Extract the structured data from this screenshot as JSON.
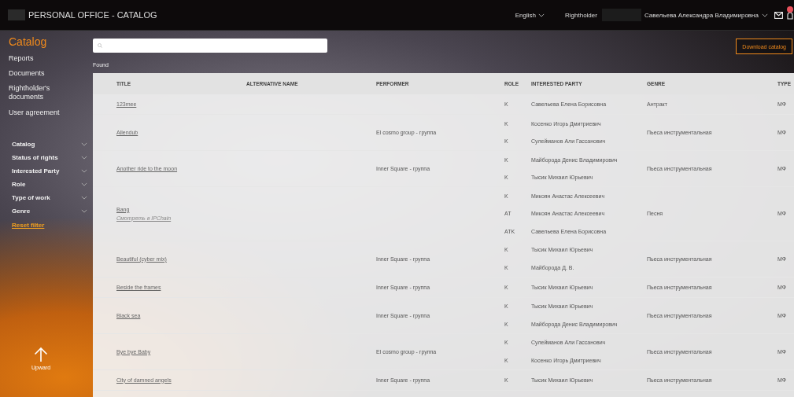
{
  "top_bar": {
    "title": "PERSONAL OFFICE - CATALOG",
    "language": "English",
    "role_label": "Rightholder",
    "user_name": "Савельева Александра Владимировна"
  },
  "sidebar": {
    "nav": [
      {
        "label": "Catalog",
        "selected": true
      },
      {
        "label": "Reports",
        "selected": false
      },
      {
        "label": "Documents",
        "selected": false
      },
      {
        "label": "Rightholder's documents",
        "selected": false
      },
      {
        "label": "User agreement",
        "selected": false
      }
    ],
    "filters": [
      "Catalog",
      "Status of rights",
      "Interested Party",
      "Role",
      "Type of work",
      "Genre"
    ],
    "reset_filter": "Reset filter",
    "upward": "Upward"
  },
  "found_label": "Found",
  "download_button": "Download catalog",
  "table": {
    "columns": [
      "TITLE",
      "ALTERNATIVE NAME",
      "PERFORMER",
      "ROLE",
      "INTERESTED PARTY",
      "GENRE",
      "TYPE"
    ],
    "rows": [
      {
        "title": "123mee",
        "parties": [
          {
            "role": "K",
            "name": "Савельева Елена Борисовна"
          }
        ],
        "genre": "Антракт",
        "type": "МФ"
      },
      {
        "title": "Allendub",
        "performer": "El cosmo group - группа",
        "parties": [
          {
            "role": "K",
            "name": "Косенко Игорь Дмитриевич"
          },
          {
            "role": "K",
            "name": "Сулейманов Али Гассанович"
          }
        ],
        "genre": "Пьеса инструментальная",
        "type": "МФ"
      },
      {
        "title": "Another ride to the moon",
        "performer": "Inner Square - группа",
        "parties": [
          {
            "role": "K",
            "name": "Майборода Денис Владимирович"
          },
          {
            "role": "K",
            "name": "Тысик Михаил Юрьевич"
          }
        ],
        "genre": "Пьеса инструментальная",
        "type": "МФ"
      },
      {
        "title": "Bang",
        "link": "Смотреть в IPChain",
        "parties": [
          {
            "role": "K",
            "name": "Микоян Анастас Алексеевич"
          },
          {
            "role": "AT",
            "name": "Микоян Анастас Алексеевич"
          },
          {
            "role": "ATK",
            "name": "Савельева Елена Борисовна"
          }
        ],
        "genre": "Песня",
        "type": "МФ"
      },
      {
        "title": "Beautiful (cyber mix)",
        "performer": "Inner Square - группа",
        "parties": [
          {
            "role": "K",
            "name": "Тысик Михаил Юрьевич"
          },
          {
            "role": "K",
            "name": "Майборода Д. В."
          }
        ],
        "genre": "Пьеса инструментальная",
        "type": "МФ"
      },
      {
        "title": "Beside the frames",
        "performer": "Inner Square - группа",
        "parties": [
          {
            "role": "K",
            "name": "Тысик Михаил Юрьевич"
          }
        ],
        "genre": "Пьеса инструментальная",
        "type": "МФ"
      },
      {
        "title": "Black sea",
        "performer": "Inner Square - группа",
        "parties": [
          {
            "role": "K",
            "name": "Тысик Михаил Юрьевич"
          },
          {
            "role": "K",
            "name": "Майборода Денис Владимирович"
          }
        ],
        "genre": "Пьеса инструментальная",
        "type": "МФ"
      },
      {
        "title": "Bye bye Baby",
        "performer": "El cosmo group - группа",
        "parties": [
          {
            "role": "K",
            "name": "Сулейманов Али Гассанович"
          },
          {
            "role": "K",
            "name": "Косенко Игорь Дмитриевич"
          }
        ],
        "genre": "Пьеса инструментальная",
        "type": "МФ"
      },
      {
        "title": "City of damned angels",
        "performer": "Inner Square - группа",
        "parties": [
          {
            "role": "K",
            "name": "Тысик Михаил Юрьевич"
          }
        ],
        "genre": "Пьеса инструментальная",
        "type": "МФ"
      }
    ]
  }
}
